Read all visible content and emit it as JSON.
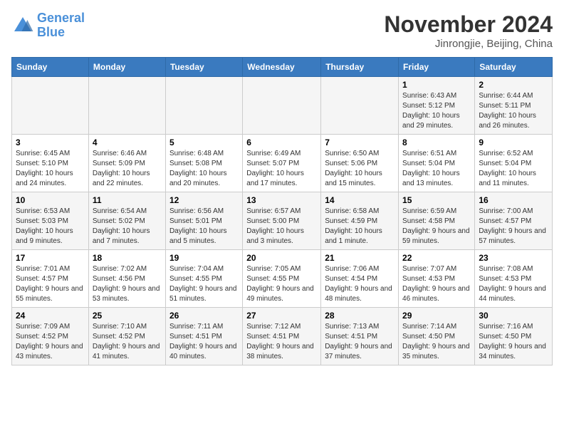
{
  "header": {
    "logo_line1": "General",
    "logo_line2": "Blue",
    "month": "November 2024",
    "location": "Jinrongjie, Beijing, China"
  },
  "weekdays": [
    "Sunday",
    "Monday",
    "Tuesday",
    "Wednesday",
    "Thursday",
    "Friday",
    "Saturday"
  ],
  "weeks": [
    [
      {
        "day": "",
        "info": ""
      },
      {
        "day": "",
        "info": ""
      },
      {
        "day": "",
        "info": ""
      },
      {
        "day": "",
        "info": ""
      },
      {
        "day": "",
        "info": ""
      },
      {
        "day": "1",
        "info": "Sunrise: 6:43 AM\nSunset: 5:12 PM\nDaylight: 10 hours and 29 minutes."
      },
      {
        "day": "2",
        "info": "Sunrise: 6:44 AM\nSunset: 5:11 PM\nDaylight: 10 hours and 26 minutes."
      }
    ],
    [
      {
        "day": "3",
        "info": "Sunrise: 6:45 AM\nSunset: 5:10 PM\nDaylight: 10 hours and 24 minutes."
      },
      {
        "day": "4",
        "info": "Sunrise: 6:46 AM\nSunset: 5:09 PM\nDaylight: 10 hours and 22 minutes."
      },
      {
        "day": "5",
        "info": "Sunrise: 6:48 AM\nSunset: 5:08 PM\nDaylight: 10 hours and 20 minutes."
      },
      {
        "day": "6",
        "info": "Sunrise: 6:49 AM\nSunset: 5:07 PM\nDaylight: 10 hours and 17 minutes."
      },
      {
        "day": "7",
        "info": "Sunrise: 6:50 AM\nSunset: 5:06 PM\nDaylight: 10 hours and 15 minutes."
      },
      {
        "day": "8",
        "info": "Sunrise: 6:51 AM\nSunset: 5:04 PM\nDaylight: 10 hours and 13 minutes."
      },
      {
        "day": "9",
        "info": "Sunrise: 6:52 AM\nSunset: 5:04 PM\nDaylight: 10 hours and 11 minutes."
      }
    ],
    [
      {
        "day": "10",
        "info": "Sunrise: 6:53 AM\nSunset: 5:03 PM\nDaylight: 10 hours and 9 minutes."
      },
      {
        "day": "11",
        "info": "Sunrise: 6:54 AM\nSunset: 5:02 PM\nDaylight: 10 hours and 7 minutes."
      },
      {
        "day": "12",
        "info": "Sunrise: 6:56 AM\nSunset: 5:01 PM\nDaylight: 10 hours and 5 minutes."
      },
      {
        "day": "13",
        "info": "Sunrise: 6:57 AM\nSunset: 5:00 PM\nDaylight: 10 hours and 3 minutes."
      },
      {
        "day": "14",
        "info": "Sunrise: 6:58 AM\nSunset: 4:59 PM\nDaylight: 10 hours and 1 minute."
      },
      {
        "day": "15",
        "info": "Sunrise: 6:59 AM\nSunset: 4:58 PM\nDaylight: 9 hours and 59 minutes."
      },
      {
        "day": "16",
        "info": "Sunrise: 7:00 AM\nSunset: 4:57 PM\nDaylight: 9 hours and 57 minutes."
      }
    ],
    [
      {
        "day": "17",
        "info": "Sunrise: 7:01 AM\nSunset: 4:57 PM\nDaylight: 9 hours and 55 minutes."
      },
      {
        "day": "18",
        "info": "Sunrise: 7:02 AM\nSunset: 4:56 PM\nDaylight: 9 hours and 53 minutes."
      },
      {
        "day": "19",
        "info": "Sunrise: 7:04 AM\nSunset: 4:55 PM\nDaylight: 9 hours and 51 minutes."
      },
      {
        "day": "20",
        "info": "Sunrise: 7:05 AM\nSunset: 4:55 PM\nDaylight: 9 hours and 49 minutes."
      },
      {
        "day": "21",
        "info": "Sunrise: 7:06 AM\nSunset: 4:54 PM\nDaylight: 9 hours and 48 minutes."
      },
      {
        "day": "22",
        "info": "Sunrise: 7:07 AM\nSunset: 4:53 PM\nDaylight: 9 hours and 46 minutes."
      },
      {
        "day": "23",
        "info": "Sunrise: 7:08 AM\nSunset: 4:53 PM\nDaylight: 9 hours and 44 minutes."
      }
    ],
    [
      {
        "day": "24",
        "info": "Sunrise: 7:09 AM\nSunset: 4:52 PM\nDaylight: 9 hours and 43 minutes."
      },
      {
        "day": "25",
        "info": "Sunrise: 7:10 AM\nSunset: 4:52 PM\nDaylight: 9 hours and 41 minutes."
      },
      {
        "day": "26",
        "info": "Sunrise: 7:11 AM\nSunset: 4:51 PM\nDaylight: 9 hours and 40 minutes."
      },
      {
        "day": "27",
        "info": "Sunrise: 7:12 AM\nSunset: 4:51 PM\nDaylight: 9 hours and 38 minutes."
      },
      {
        "day": "28",
        "info": "Sunrise: 7:13 AM\nSunset: 4:51 PM\nDaylight: 9 hours and 37 minutes."
      },
      {
        "day": "29",
        "info": "Sunrise: 7:14 AM\nSunset: 4:50 PM\nDaylight: 9 hours and 35 minutes."
      },
      {
        "day": "30",
        "info": "Sunrise: 7:16 AM\nSunset: 4:50 PM\nDaylight: 9 hours and 34 minutes."
      }
    ]
  ]
}
